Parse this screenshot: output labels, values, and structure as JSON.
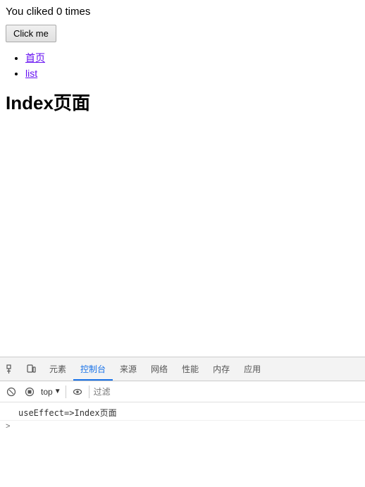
{
  "main": {
    "click_count_text": "You cliked 0 times",
    "click_button_label": "Click me",
    "nav_links": [
      {
        "label": "首页",
        "href": "#"
      },
      {
        "label": "list",
        "href": "#"
      }
    ],
    "page_title": "Index页面"
  },
  "devtools": {
    "tabs": [
      {
        "label": "元素",
        "active": false
      },
      {
        "label": "控制台",
        "active": true
      },
      {
        "label": "来源",
        "active": false
      },
      {
        "label": "网络",
        "active": false
      },
      {
        "label": "性能",
        "active": false
      },
      {
        "label": "内存",
        "active": false
      },
      {
        "label": "应用",
        "active": false
      }
    ],
    "toolbar": {
      "level_selector": "top",
      "filter_placeholder": "过滤"
    },
    "console_lines": [
      {
        "text": "useEffect=>Index页面"
      }
    ],
    "expand_symbol": ">"
  }
}
